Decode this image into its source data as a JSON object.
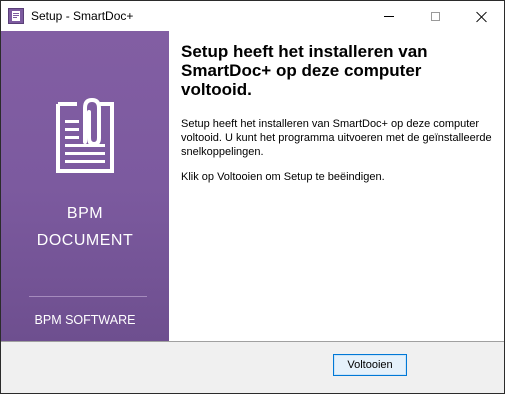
{
  "window": {
    "title": "Setup - SmartDoc+"
  },
  "titlebar": {
    "app_icon": "installer-icon",
    "minimize_icon": "minimize-icon",
    "maximize_icon": "maximize-icon",
    "close_icon": "close-icon"
  },
  "sidebar": {
    "icon": "document-paperclip-icon",
    "brand_line1": "BPM",
    "brand_line2": "DOCUMENT",
    "footer": "BPM SOFTWARE",
    "colors": {
      "background": "#7c5a9f",
      "text": "#ffffff",
      "divider": "#a58bbd"
    }
  },
  "content": {
    "heading": "Setup heeft het installeren van SmartDoc+ op deze computer voltooid.",
    "paragraph1": "Setup heeft het installeren van SmartDoc+ op deze computer voltooid. U kunt het programma uitvoeren met de geïnstalleerde snelkoppelingen.",
    "paragraph2": "Klik op Voltooien om Setup te beëindigen."
  },
  "footer": {
    "finish_label": "Voltooien",
    "colors": {
      "button_border": "#0078d7",
      "button_bg": "#e5f1fb",
      "panel_bg": "#f0f0f0"
    }
  }
}
